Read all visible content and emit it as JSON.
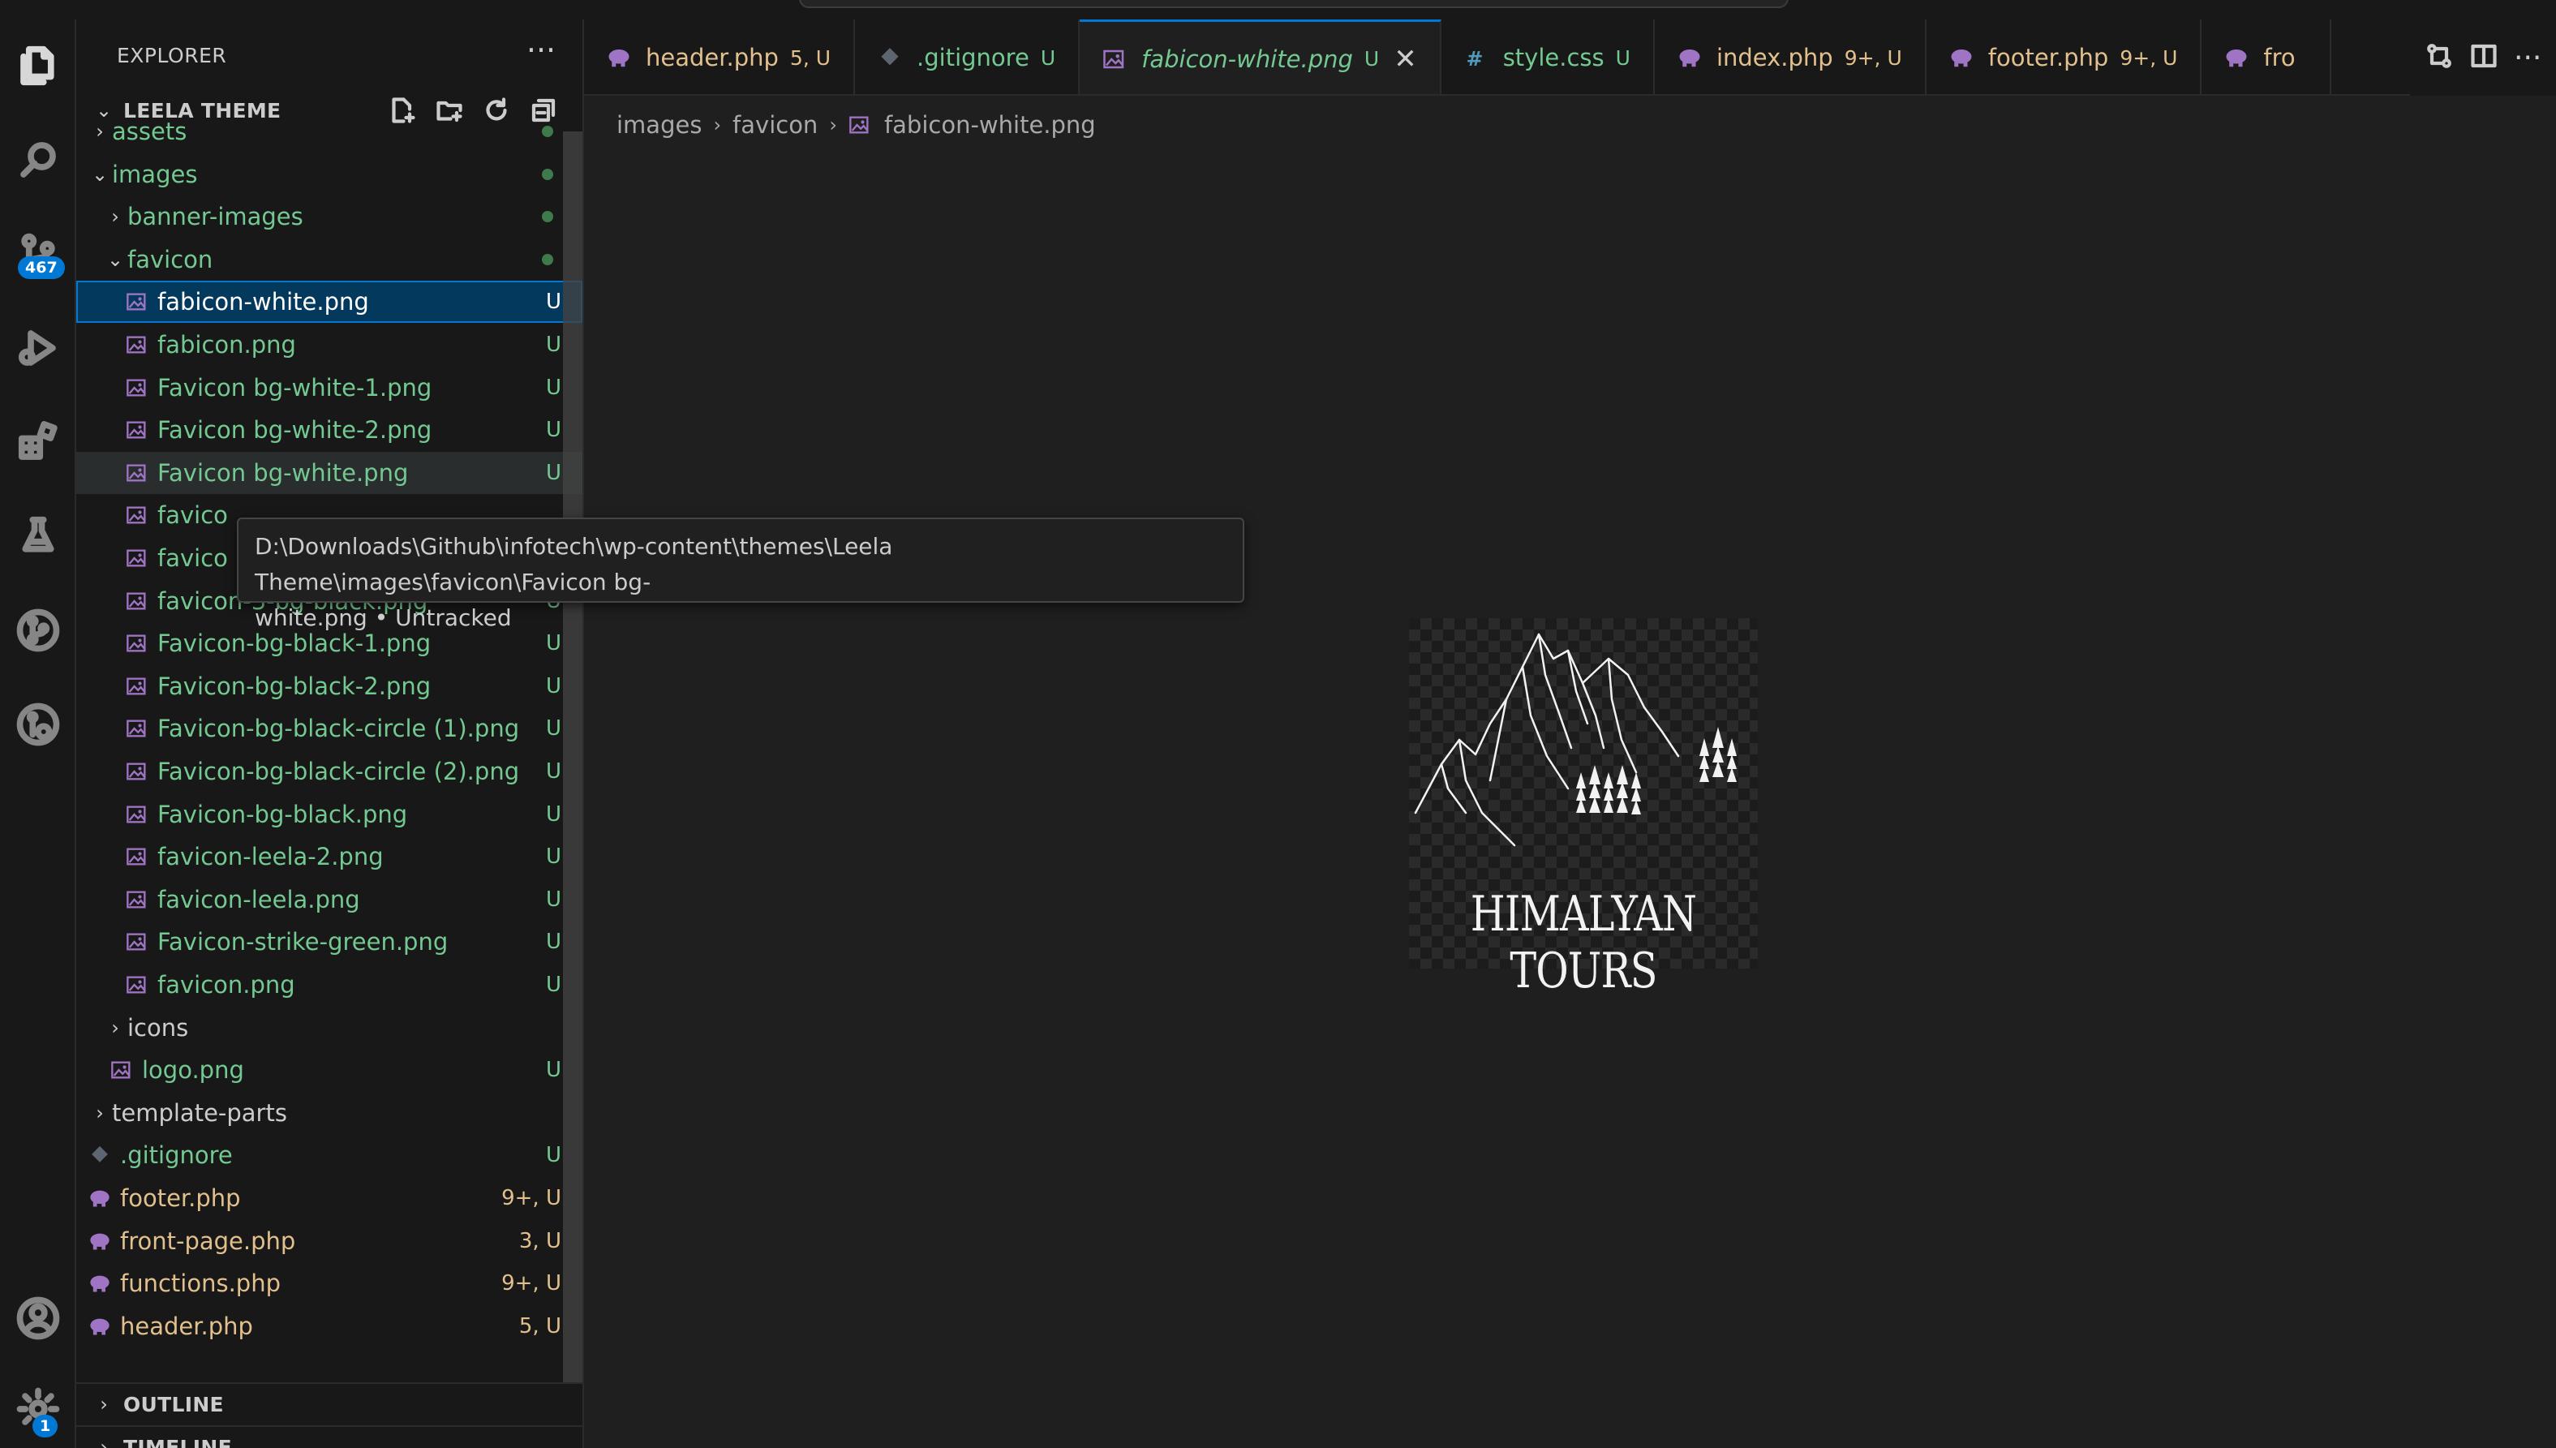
{
  "explorer": {
    "title": "EXPLORER",
    "more_label": "···"
  },
  "project": {
    "name": "LEELA THEME"
  },
  "sections": {
    "outline": "OUTLINE",
    "timeline": "TIMELINE"
  },
  "activity": {
    "scm_badge": "467",
    "settings_badge": "1"
  },
  "tree": [
    {
      "label": "assets",
      "kind": "folder",
      "state": "collapsed",
      "color": "green",
      "deco": "dot"
    },
    {
      "label": "images",
      "kind": "folder",
      "state": "expanded",
      "color": "green",
      "deco": "dot"
    },
    {
      "label": "banner-images",
      "kind": "folder",
      "state": "collapsed",
      "color": "green",
      "deco": "dot"
    },
    {
      "label": "favicon",
      "kind": "folder",
      "state": "expanded",
      "color": "green",
      "deco": "dot"
    },
    {
      "label": "fabicon-white.png",
      "kind": "image",
      "color": "white",
      "deco": "U",
      "selected": true
    },
    {
      "label": "fabicon.png",
      "kind": "image",
      "color": "green",
      "deco": "U"
    },
    {
      "label": "Favicon bg-white-1.png",
      "kind": "image",
      "color": "green",
      "deco": "U"
    },
    {
      "label": "Favicon bg-white-2.png",
      "kind": "image",
      "color": "green",
      "deco": "U"
    },
    {
      "label": "Favicon bg-white.png",
      "kind": "image",
      "color": "green",
      "deco": "U",
      "hovered": true
    },
    {
      "label": "favico",
      "kind": "image",
      "color": "green",
      "deco": ""
    },
    {
      "label": "favico",
      "kind": "image",
      "color": "green",
      "deco": ""
    },
    {
      "label": "favicon-3-bg-black.png",
      "kind": "image",
      "color": "green",
      "deco": "U"
    },
    {
      "label": "Favicon-bg-black-1.png",
      "kind": "image",
      "color": "green",
      "deco": "U"
    },
    {
      "label": "Favicon-bg-black-2.png",
      "kind": "image",
      "color": "green",
      "deco": "U"
    },
    {
      "label": "Favicon-bg-black-circle (1).png",
      "kind": "image",
      "color": "green",
      "deco": "U"
    },
    {
      "label": "Favicon-bg-black-circle (2).png",
      "kind": "image",
      "color": "green",
      "deco": "U"
    },
    {
      "label": "Favicon-bg-black.png",
      "kind": "image",
      "color": "green",
      "deco": "U"
    },
    {
      "label": "favicon-leela-2.png",
      "kind": "image",
      "color": "green",
      "deco": "U"
    },
    {
      "label": "favicon-leela.png",
      "kind": "image",
      "color": "green",
      "deco": "U"
    },
    {
      "label": "Favicon-strike-green.png",
      "kind": "image",
      "color": "green",
      "deco": "U"
    },
    {
      "label": "favicon.png",
      "kind": "image",
      "color": "green",
      "deco": "U"
    },
    {
      "label": "icons",
      "kind": "folder",
      "state": "collapsed",
      "color": "plain",
      "deco": ""
    },
    {
      "label": "logo.png",
      "kind": "image",
      "color": "green",
      "deco": "U"
    },
    {
      "label": "template-parts",
      "kind": "folder",
      "state": "collapsed",
      "color": "plain",
      "deco": ""
    },
    {
      "label": ".gitignore",
      "kind": "git",
      "color": "green",
      "deco": "U"
    },
    {
      "label": "footer.php",
      "kind": "php",
      "color": "yellow",
      "deco": "9+, U"
    },
    {
      "label": "front-page.php",
      "kind": "php",
      "color": "yellow",
      "deco": "3, U"
    },
    {
      "label": "functions.php",
      "kind": "php",
      "color": "yellow",
      "deco": "9+, U"
    },
    {
      "label": "header.php",
      "kind": "php",
      "color": "yellow",
      "deco": "5, U"
    }
  ],
  "tabs": [
    {
      "label": "header.php",
      "deco": "5, U",
      "kind": "php",
      "color": "yellow"
    },
    {
      "label": ".gitignore",
      "deco": "U",
      "kind": "git",
      "color": "green"
    },
    {
      "label": "fabicon-white.png",
      "deco": "U",
      "kind": "image",
      "color": "green",
      "active": true,
      "close": "✕"
    },
    {
      "label": "style.css",
      "deco": "U",
      "kind": "css",
      "color": "green"
    },
    {
      "label": "index.php",
      "deco": "9+, U",
      "kind": "php",
      "color": "yellow"
    },
    {
      "label": "footer.php",
      "deco": "9+, U",
      "kind": "php",
      "color": "yellow"
    },
    {
      "label": "fro",
      "deco": "",
      "kind": "php",
      "color": "yellow"
    }
  ],
  "breadcrumb": [
    "images",
    "favicon",
    "fabicon-white.png"
  ],
  "preview": {
    "caption": "HIMALYAN TOURS"
  },
  "tooltip": {
    "line1": "D:\\Downloads\\Github\\infotech\\wp-content\\themes\\Leela Theme\\images\\favicon\\Favicon bg-",
    "line2": "white.png • Untracked"
  },
  "colors": {
    "accent": "#0078d4",
    "untracked": "#73c991",
    "modified": "#e2c08d",
    "php_icon": "#a074c4",
    "css_icon": "#519aba"
  }
}
